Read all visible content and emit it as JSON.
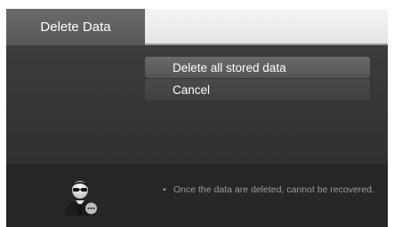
{
  "header": {
    "title": "Delete Data"
  },
  "menu": {
    "items": [
      {
        "label": "Delete all stored data"
      },
      {
        "label": "Cancel"
      }
    ]
  },
  "footer": {
    "bullet": "•",
    "message": "Once the data are deleted, cannot be recovered."
  },
  "icons": {
    "avatar": "user-avatar-icon"
  }
}
